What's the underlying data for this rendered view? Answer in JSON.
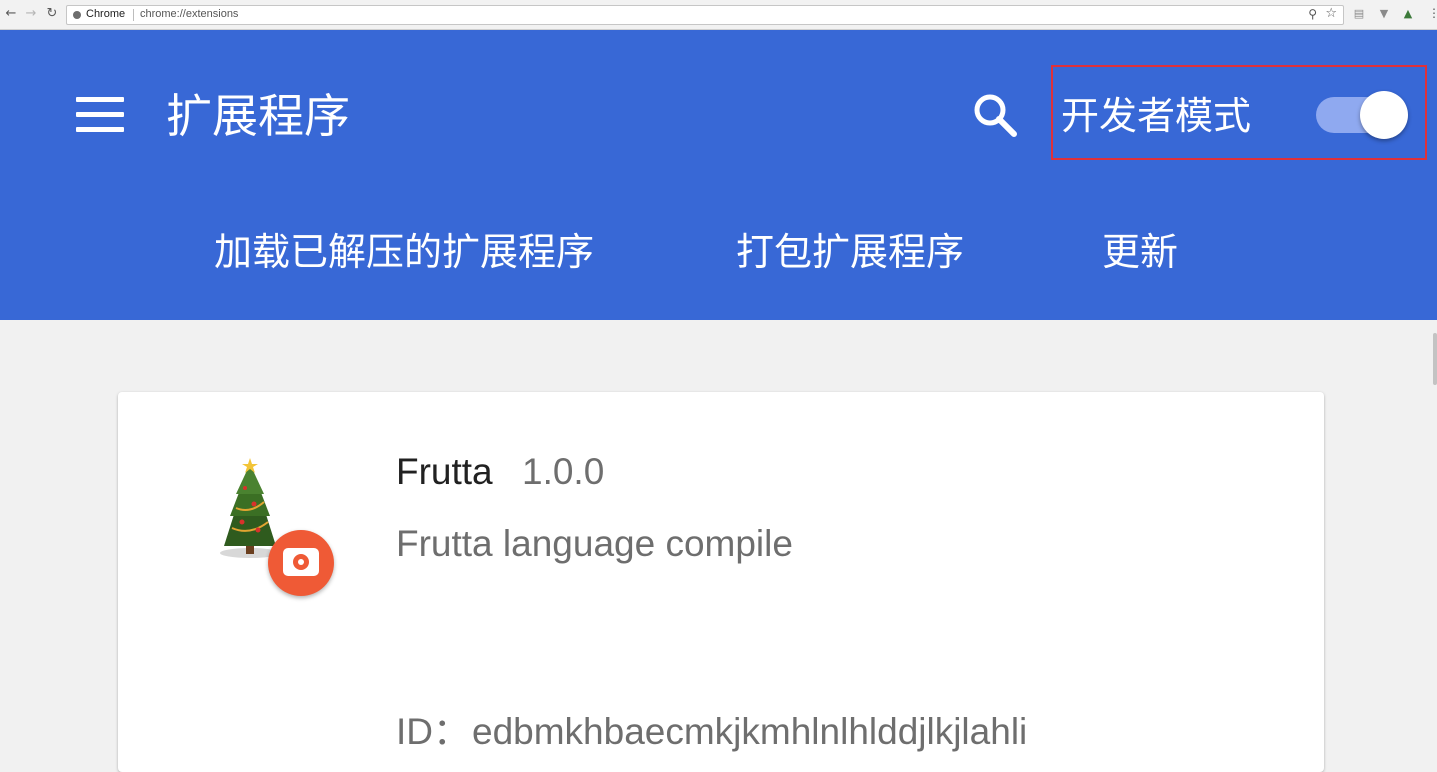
{
  "browser": {
    "origin_label": "Chrome",
    "url": "chrome://extensions",
    "icons": [
      "back-icon",
      "forward-icon",
      "reload-icon",
      "zoom-icon",
      "star-icon",
      "menu-icon"
    ]
  },
  "header": {
    "title": "扩展程序",
    "dev_mode_label": "开发者模式",
    "dev_mode_enabled": true,
    "background_color": "#3868d6",
    "highlight_color": "#e0313a",
    "actions": {
      "load_unpacked": "加载已解压的扩展程序",
      "pack": "打包扩展程序",
      "update": "更新"
    }
  },
  "extension": {
    "name": "Frutta",
    "version": "1.0.0",
    "description": "Frutta language compile",
    "id_label": "ID：",
    "id": "edbmkhbaecmkjkmhlnlhlddjlkjlahli",
    "icon": "christmas-tree-icon",
    "badge_icon": "unpacked-extension-badge-icon",
    "badge_color": "#ef5a36"
  }
}
